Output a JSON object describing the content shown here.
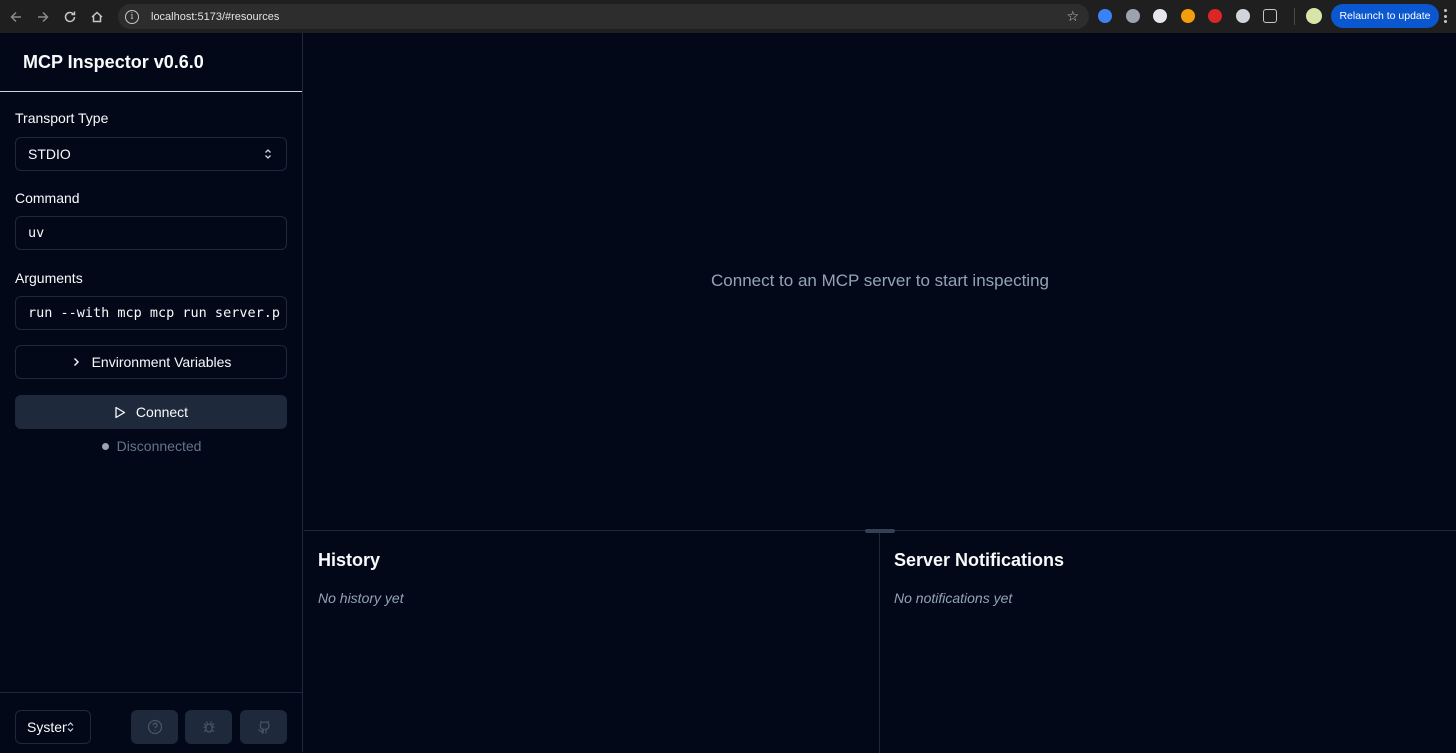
{
  "browser": {
    "url": "localhost:5173/#resources",
    "relaunch_label": "Relaunch to update",
    "extension_colors": [
      "#3b82f6",
      "#9ca3af",
      "#e5e7eb",
      "#f59e0b",
      "#dc2626",
      "#d1d5db",
      "#c7c7c7"
    ]
  },
  "sidebar": {
    "title": "MCP Inspector v0.6.0",
    "transport": {
      "label": "Transport Type",
      "value": "STDIO"
    },
    "command": {
      "label": "Command",
      "value": "uv"
    },
    "arguments": {
      "label": "Arguments",
      "value": "run --with mcp mcp run server.p"
    },
    "env_button": "Environment Variables",
    "connect_button": "Connect",
    "status": "Disconnected",
    "theme_value": "System"
  },
  "main": {
    "placeholder": "Connect to an MCP server to start inspecting",
    "history": {
      "title": "History",
      "empty": "No history yet"
    },
    "notifications": {
      "title": "Server Notifications",
      "empty": "No notifications yet"
    }
  },
  "colors": {
    "background": "#020817",
    "border": "#1e293b",
    "accent_button": "#0b57d0",
    "muted_text": "#94a3b8"
  }
}
